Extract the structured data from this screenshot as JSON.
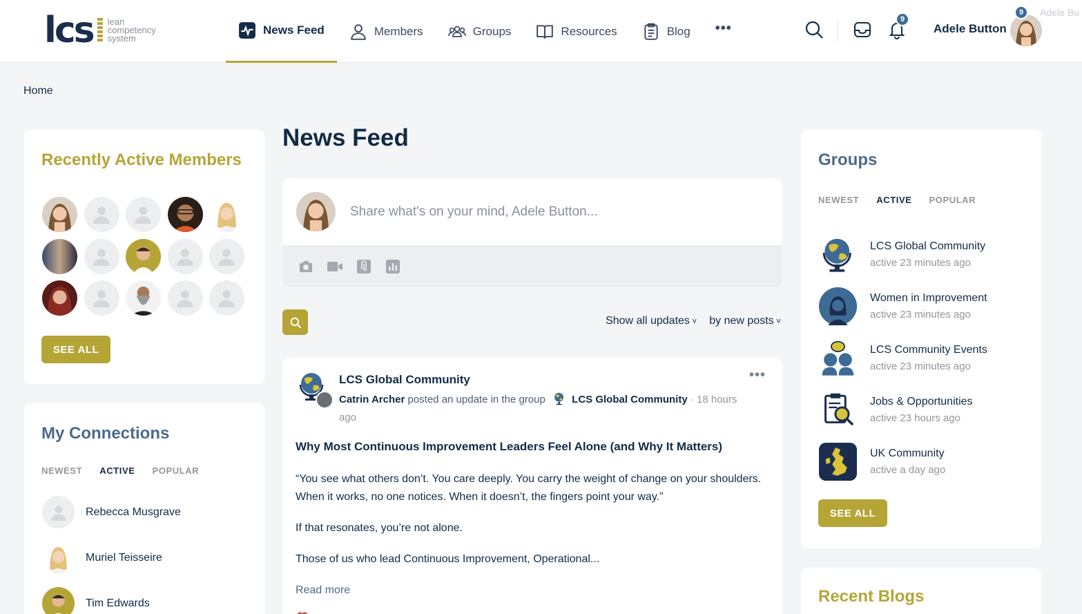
{
  "header": {
    "logo": {
      "mark": "lcs",
      "line1": "lean",
      "line2": "competency",
      "line3": "system"
    },
    "nav": [
      {
        "label": "News Feed",
        "icon": "pulse-icon",
        "active": true
      },
      {
        "label": "Members",
        "icon": "person-icon"
      },
      {
        "label": "Groups",
        "icon": "people-icon"
      },
      {
        "label": "Resources",
        "icon": "book-icon"
      },
      {
        "label": "Blog",
        "icon": "document-icon"
      }
    ],
    "more_label": "•••",
    "notifications_count": "9",
    "user_badge_count": "9",
    "user_name": "Adele Button",
    "ghost_text": "Adele Bu"
  },
  "breadcrumb": "Home",
  "left": {
    "recent_members_title": "Recently Active Members",
    "see_all_label": "SEE ALL",
    "connections_title": "My Connections",
    "tabs": [
      "NEWEST",
      "ACTIVE",
      "POPULAR"
    ],
    "connections": [
      {
        "name": "Rebecca Musgrave"
      },
      {
        "name": "Muriel Teisseire"
      },
      {
        "name": "Tim Edwards"
      }
    ]
  },
  "main": {
    "title": "News Feed",
    "composer_placeholder": "Share what's on your mind, Adele Button...",
    "filter_show": "Show all updates",
    "filter_order": "by new posts",
    "post": {
      "group": "LCS Global Community",
      "author": "Catrin Archer",
      "action": "posted an update in the group",
      "group_ref": "LCS Global Community",
      "time_a": "· 18 hours",
      "time_b": "ago",
      "title": "Why Most Continuous Improvement Leaders Feel Alone (and Why It Matters)",
      "p1": "“You see what others don’t. You care deeply. You carry the weight of change on your shoulders. When it works, no one notices. When it doesn’t, the fingers point your way.”",
      "p2": "If that resonates, you’re not alone.",
      "p3": "Those of us who lead Continuous Improvement, Operational...",
      "read_more": "Read more",
      "more_dots": "•••"
    }
  },
  "right": {
    "groups_title": "Groups",
    "tabs": [
      "NEWEST",
      "ACTIVE",
      "POPULAR"
    ],
    "groups": [
      {
        "name": "LCS Global Community",
        "activity": "active 23 minutes ago"
      },
      {
        "name": "Women in Improvement",
        "activity": "active 23 minutes ago"
      },
      {
        "name": "LCS Community Events",
        "activity": "active 23 minutes ago"
      },
      {
        "name": "Jobs & Opportunities",
        "activity": "active 23 hours ago"
      },
      {
        "name": "UK Community",
        "activity": "active a day ago"
      }
    ],
    "see_all_label": "SEE ALL",
    "blogs_title": "Recent Blogs"
  },
  "colors": {
    "accent": "#b5a537",
    "navy": "#122b46",
    "slate": "#4d6a8c",
    "badge": "#3e6b95"
  }
}
